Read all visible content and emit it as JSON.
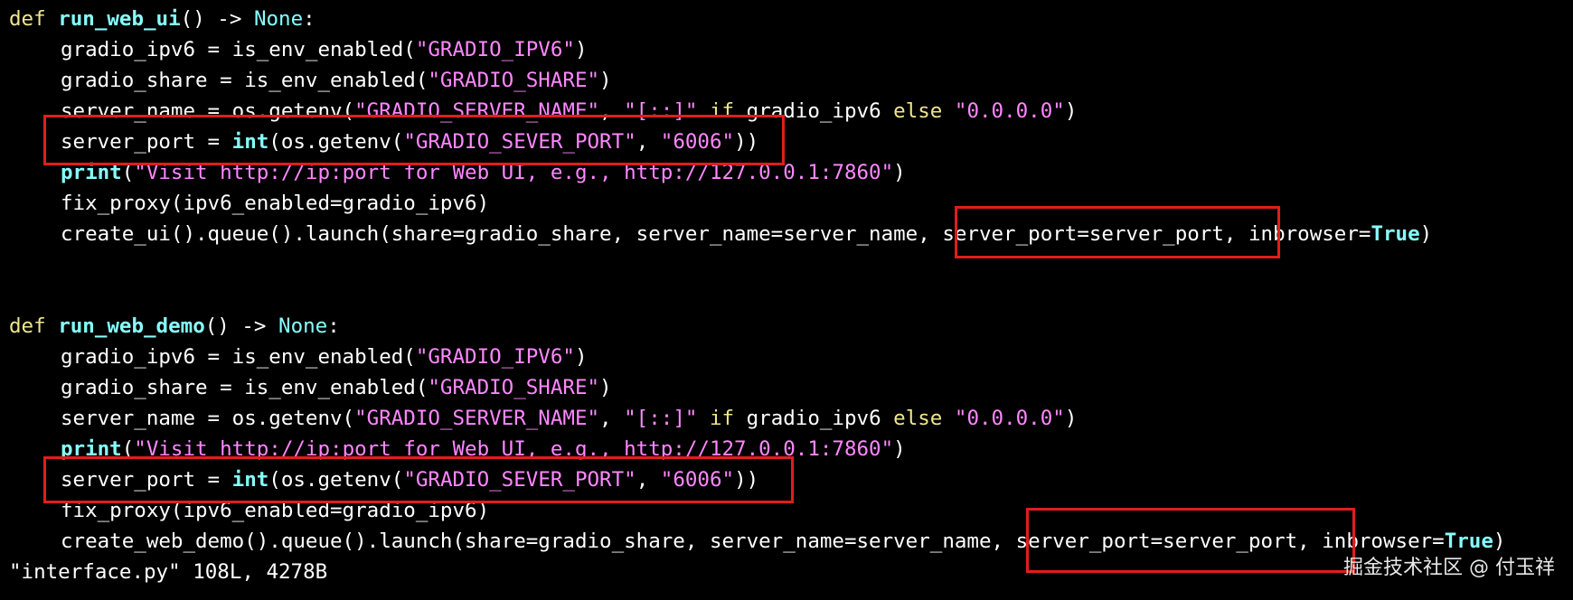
{
  "block1": {
    "def": "def",
    "name": "run_web_ui",
    "sig_mid": "() -> ",
    "ret": "None",
    "colon": ":",
    "l1a": "gradio_ipv6 = is_env_enabled(",
    "l1s": "\"GRADIO_IPV6\"",
    "l1b": ")",
    "l2a": "gradio_share = is_env_enabled(",
    "l2s": "\"GRADIO_SHARE\"",
    "l2b": ")",
    "l3a": "server_name = os.getenv(",
    "l3s1": "\"GRADIO_SERVER_NAME\"",
    "l3c": ", ",
    "l3s2": "\"[::]\"",
    "l3if": " if",
    "l3m": " gradio_ipv6 ",
    "l3else": "else",
    "l3sp": " ",
    "l3s3": "\"0.0.0.0\"",
    "l3b": ")",
    "l4a": "server_port = ",
    "l4int": "int",
    "l4b": "(os.getenv(",
    "l4s1": "\"GRADIO_SEVER_PORT\"",
    "l4c": ", ",
    "l4s2": "\"6006\"",
    "l4d": "))",
    "l5print": "print",
    "l5a": "(",
    "l5s": "\"Visit http://ip:port for Web UI, e.g., http://127.0.0.1:7860\"",
    "l5b": ")",
    "l6": "fix_proxy(ipv6_enabled=gradio_ipv6)",
    "l7a": "create_ui().queue().launch(share=gradio_share, server_name=server_name, server_port=server_port, inbrowser=",
    "l7true": "True",
    "l7b": ")"
  },
  "block2": {
    "def": "def",
    "name": "run_web_demo",
    "sig_mid": "() -> ",
    "ret": "None",
    "colon": ":",
    "l1a": "gradio_ipv6 = is_env_enabled(",
    "l1s": "\"GRADIO_IPV6\"",
    "l1b": ")",
    "l2a": "gradio_share = is_env_enabled(",
    "l2s": "\"GRADIO_SHARE\"",
    "l2b": ")",
    "l3a": "server_name = os.getenv(",
    "l3s1": "\"GRADIO_SERVER_NAME\"",
    "l3c": ", ",
    "l3s2": "\"[::]\"",
    "l3if": " if",
    "l3m": " gradio_ipv6 ",
    "l3else": "else",
    "l3sp": " ",
    "l3s3": "\"0.0.0.0\"",
    "l3b": ")",
    "l4print": "print",
    "l4a": "(",
    "l4s": "\"Visit http://ip:port for Web UI, e.g., http://127.0.0.1:7860\"",
    "l4b": ")",
    "l5a": "server_port = ",
    "l5int": "int",
    "l5b": "(os.getenv(",
    "l5s1": "\"GRADIO_SEVER_PORT\"",
    "l5c": ", ",
    "l5s2": "\"6006\"",
    "l5d": "))",
    "l6": "fix_proxy(ipv6_enabled=gradio_ipv6)",
    "l7a": "create_web_demo().queue().launch(share=gradio_share, server_name=server_name, server_port=server_port, inbrowser=",
    "l7true": "True",
    "l7b": ")"
  },
  "status": {
    "text": "\"interface.py\" 108L, 4278B"
  },
  "watermark": "掘金技术社区 @ 付玉祥",
  "colors": {
    "keyword": "#f0e68c",
    "function": "#87ffff",
    "string": "#ff87ff",
    "highlight_box": "#e11d1d",
    "background": "#000000"
  }
}
